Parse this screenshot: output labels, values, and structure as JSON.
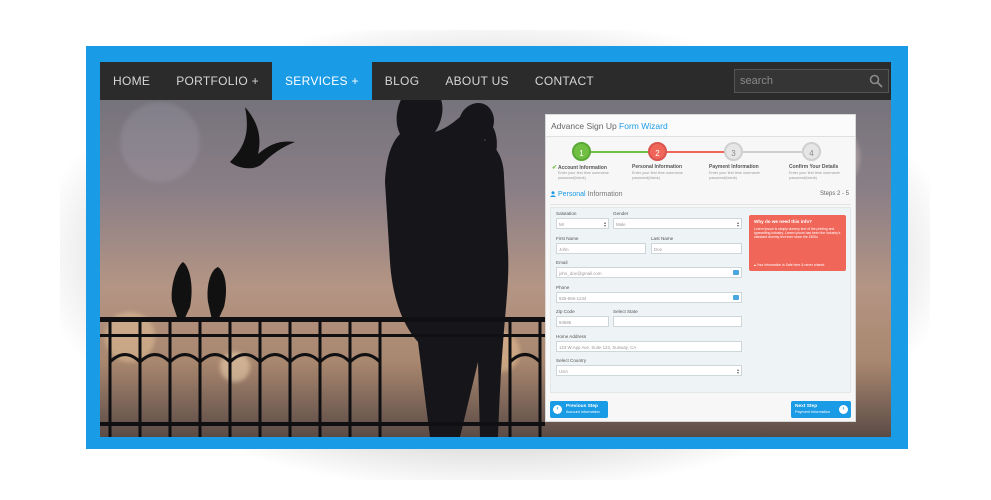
{
  "nav": {
    "items": [
      "HOME",
      "PORTFOLIO +",
      "SERVICES +",
      "BLOG",
      "ABOUT US",
      "CONTACT"
    ],
    "active_index": 2,
    "search_placeholder": "search"
  },
  "colors": {
    "accent": "#1a9be6",
    "step_done": "#72c043",
    "step_active": "#f0675a",
    "step_pending": "#cfcfcf",
    "nav_bg": "#2b2b2b"
  },
  "wizard": {
    "title_prefix": "Advance Sign Up ",
    "title_accent": "Form Wizard",
    "steps": [
      {
        "number": "1",
        "label": "Account Information",
        "desc": "Enter your first time username password(blank)",
        "state": "done"
      },
      {
        "number": "2",
        "label": "Personal Information",
        "desc": "Enter your first time username password(blank)",
        "state": "active"
      },
      {
        "number": "3",
        "label": "Payment Information",
        "desc": "Enter your first time username password(blank)",
        "state": "pending"
      },
      {
        "number": "4",
        "label": "Confirm Your Details",
        "desc": "Enter your first time username password(blank)",
        "state": "pending"
      }
    ],
    "section_accent": "Personal",
    "section_rest": " Information",
    "steps_count": "Steps 2 - 5",
    "fields": {
      "salutation_label": "Salutation",
      "salutation_value": "Mr",
      "gender_label": "Gender",
      "gender_value": "Male",
      "first_name_label": "First Name",
      "first_name_placeholder": "John",
      "last_name_label": "Last Name",
      "last_name_placeholder": "Doe",
      "email_label": "Email",
      "email_placeholder": "john_doe@gmail.com",
      "phone_label": "Phone",
      "phone_placeholder": "925-555-1234",
      "zip_label": "Zip Code",
      "zip_placeholder": "94586",
      "state_label": "Select State",
      "state_value": "",
      "address_label": "Home Address",
      "address_placeholder": "123 W.App Ave. Suite 123, Sunway, CA",
      "country_label": "Select Country",
      "country_value": "USA"
    },
    "info": {
      "title": "Why do we need this info?",
      "text": "Lorem Ipsum is simply dummy text of the printing and typesetting industry. Lorem Ipsum has been the industry's standard dummy text ever since the 1500s",
      "note": "Your information is Safe here & never shared."
    },
    "prev_button": {
      "label": "Previous Step",
      "sub": "Account Information"
    },
    "next_button": {
      "label": "Next Step",
      "sub": "Payment Information"
    }
  }
}
